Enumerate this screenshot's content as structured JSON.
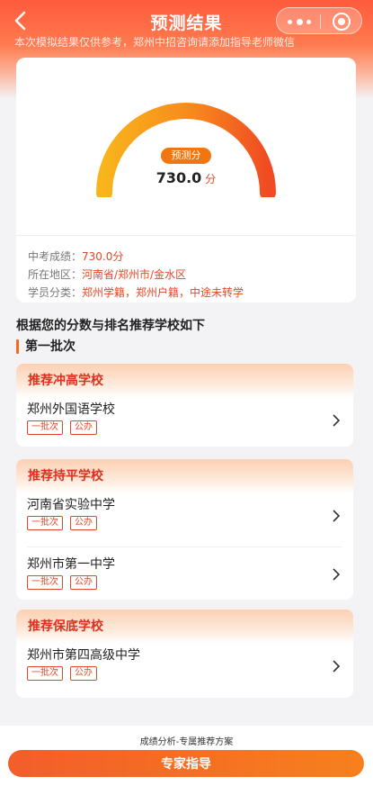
{
  "nav": {
    "title": "预测结果"
  },
  "notice": {
    "text": "本次模拟结果仅供参考，郑州中招咨询请添加指导老师微信"
  },
  "score": {
    "badge": "预测分",
    "value": "730.0",
    "unit": "分"
  },
  "info": [
    {
      "label": "中考成绩：",
      "value": "730.0分"
    },
    {
      "label": "所在地区：",
      "value": "河南省/郑州市/金水区"
    },
    {
      "label": "学员分类：",
      "value": "郑州学籍，郑州户籍，中途未转学"
    }
  ],
  "recommend": {
    "title": "根据您的分数与排名推荐学校如下",
    "batch": "第一批次",
    "groups": [
      {
        "title": "推荐冲高学校",
        "schools": [
          {
            "name": "郑州外国语学校",
            "tags": [
              "一批次",
              "公办"
            ]
          }
        ]
      },
      {
        "title": "推荐持平学校",
        "schools": [
          {
            "name": "河南省实验中学",
            "tags": [
              "一批次",
              "公办"
            ]
          },
          {
            "name": "郑州市第一中学",
            "tags": [
              "一批次",
              "公办"
            ]
          }
        ]
      },
      {
        "title": "推荐保底学校",
        "schools": [
          {
            "name": "郑州市第四高级中学",
            "tags": [
              "一批次",
              "公办"
            ]
          }
        ]
      }
    ]
  },
  "bottom": {
    "caption": "成绩分析-专属推荐方案",
    "button_label": "专家指导"
  },
  "colors": {
    "accent": "#e3482a",
    "gauge_start": "#f8b41c",
    "gauge_end": "#f04b22"
  }
}
